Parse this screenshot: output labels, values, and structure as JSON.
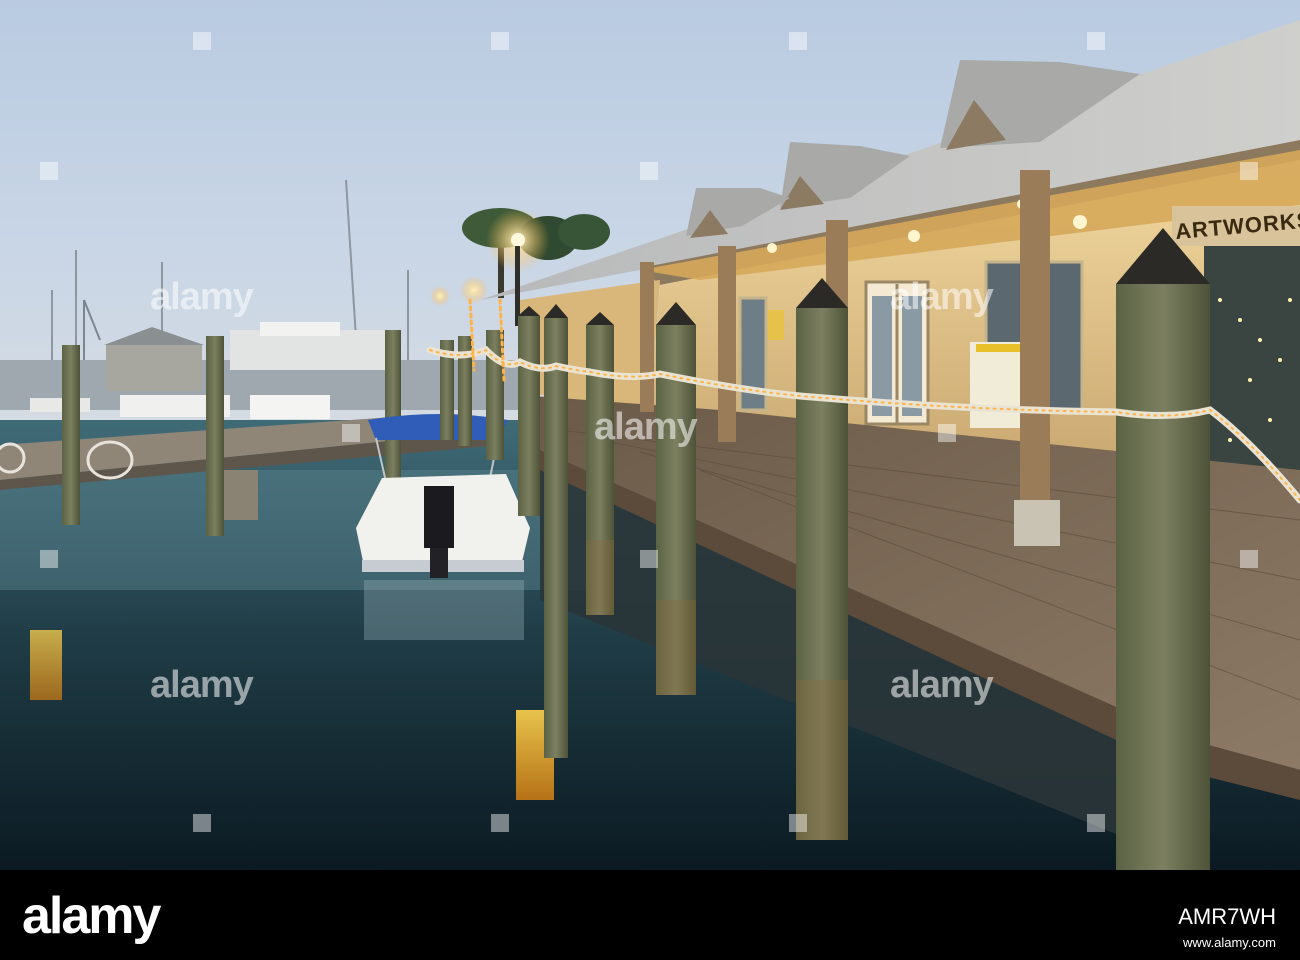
{
  "photo": {
    "subject": "Marina boardwalk at dusk with lit shops, wooden pilings, rope lights and a small boat with a blue canopy",
    "shop_sign": "ARTWORKS"
  },
  "watermark": {
    "text": "alamy",
    "color": "#ffffff"
  },
  "footer": {
    "logo": "alamy",
    "image_id": "AMR7WH",
    "url": "www.alamy.com"
  }
}
